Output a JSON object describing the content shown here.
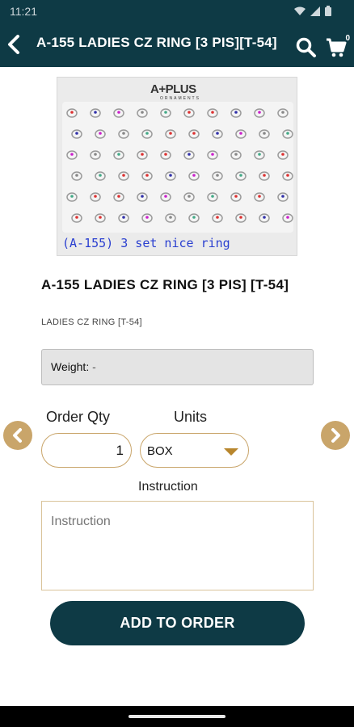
{
  "status_bar": {
    "time": "11:21",
    "icons": [
      "wifi-icon",
      "signal-icon",
      "battery-icon"
    ]
  },
  "app_bar": {
    "title": "A-155 LADIES CZ RING [3 PIS][T-54]",
    "cart_count": "0"
  },
  "product": {
    "image_logo": "A+PLUS",
    "image_logo_sub": "ORNAMENTS",
    "image_caption": "(A-155) 3 set nice ring",
    "name": "A-155 LADIES CZ RING [3 PIS] [T-54]",
    "subtitle": "LADIES CZ RING [T-54]",
    "weight_label": "Weight:",
    "weight_value": "-"
  },
  "order": {
    "qty_label": "Order Qty",
    "qty_value": "1",
    "units_label": "Units",
    "units_value": "BOX",
    "instruction_label": "Instruction",
    "instruction_placeholder": "Instruction",
    "add_button": "ADD TO ORDER"
  },
  "colors": {
    "primary": "#0e3a45",
    "accent": "#c9a56a",
    "caret": "#b8862d"
  }
}
